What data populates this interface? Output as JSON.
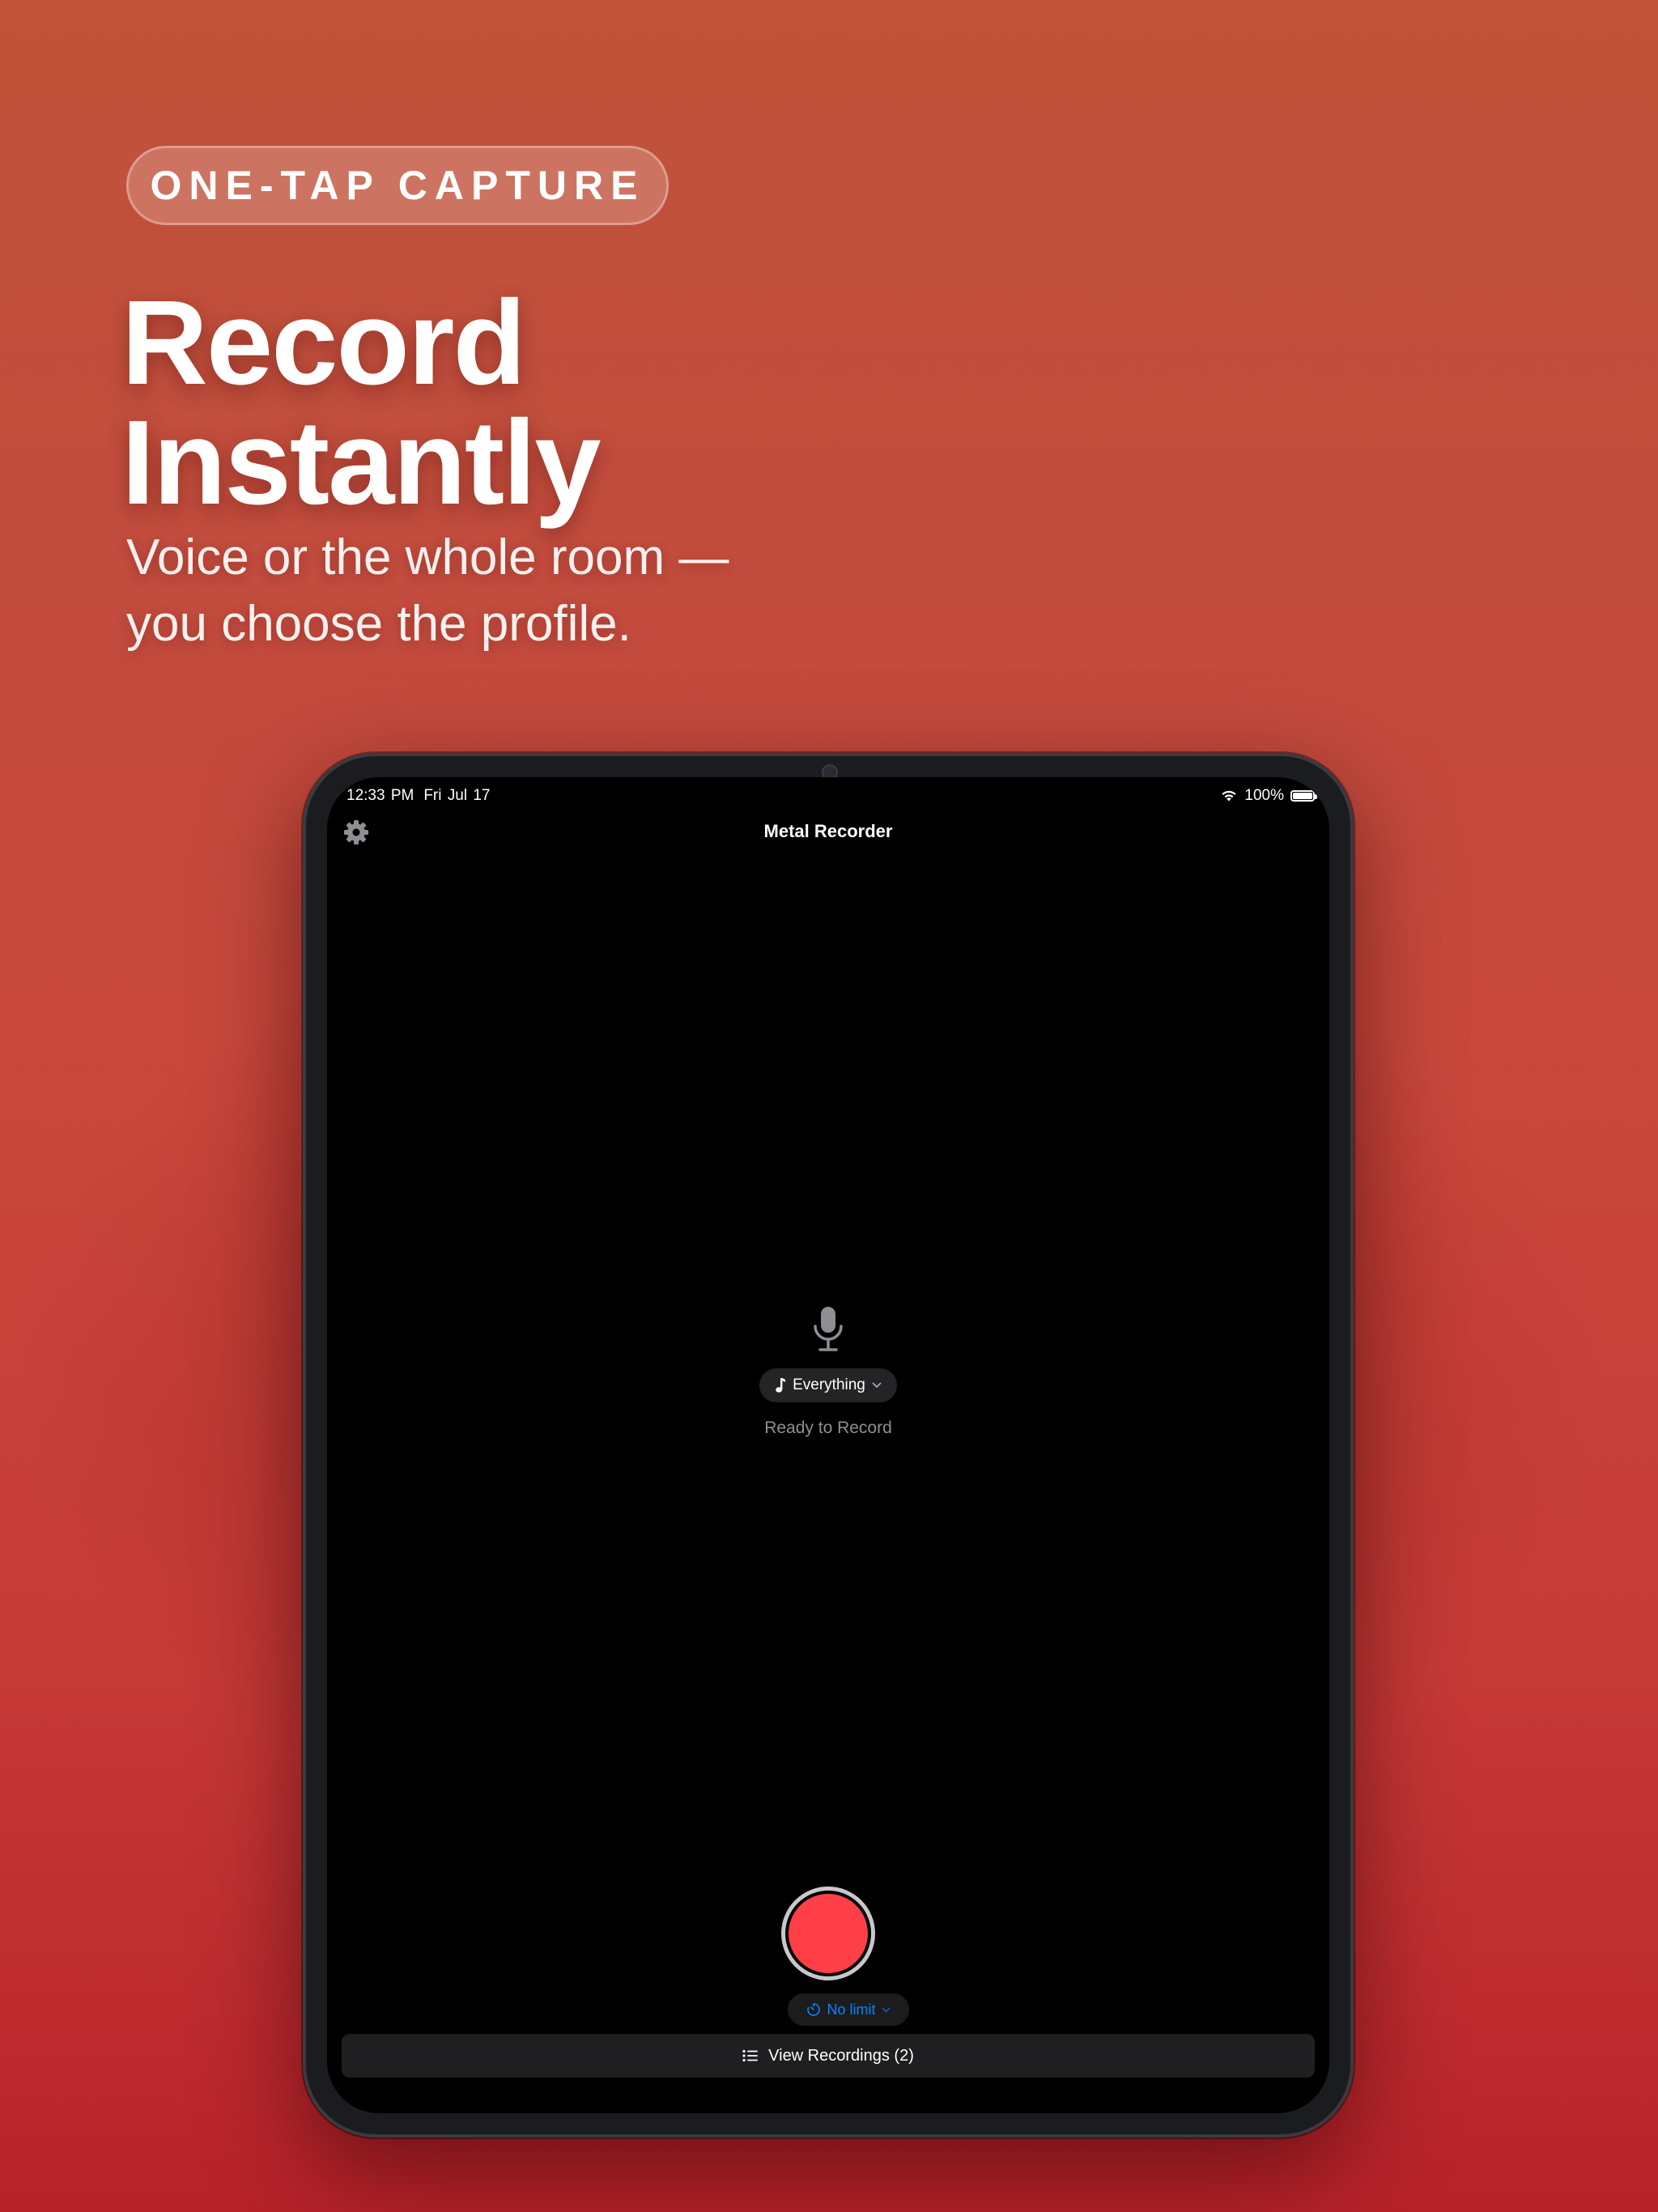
{
  "marketing": {
    "badge": "ONE-TAP CAPTURE",
    "headline_line1": "Record",
    "headline_line2": "Instantly",
    "subhead_line1": "Voice or the whole room —",
    "subhead_line2": "you choose the profile."
  },
  "status_bar": {
    "time": "12:33 PM",
    "date": "Fri Jul 17",
    "battery": "100%",
    "battery_level": 1.0
  },
  "nav": {
    "title": "Metal Recorder",
    "settings_icon": "gear-icon"
  },
  "recorder": {
    "mic_icon": "microphone-icon",
    "profile_label": "Everything",
    "profile_icon": "music-note-icon",
    "status": "Ready to Record",
    "limit_label": "No limit",
    "limit_icon": "timer-icon",
    "view_recordings": "View Recordings (2)",
    "view_icon": "list-icon"
  },
  "colors": {
    "record": "#fe3f47",
    "accent": "#0a84ff",
    "background_top": "#c0533a",
    "background_bottom": "#b8222a"
  }
}
